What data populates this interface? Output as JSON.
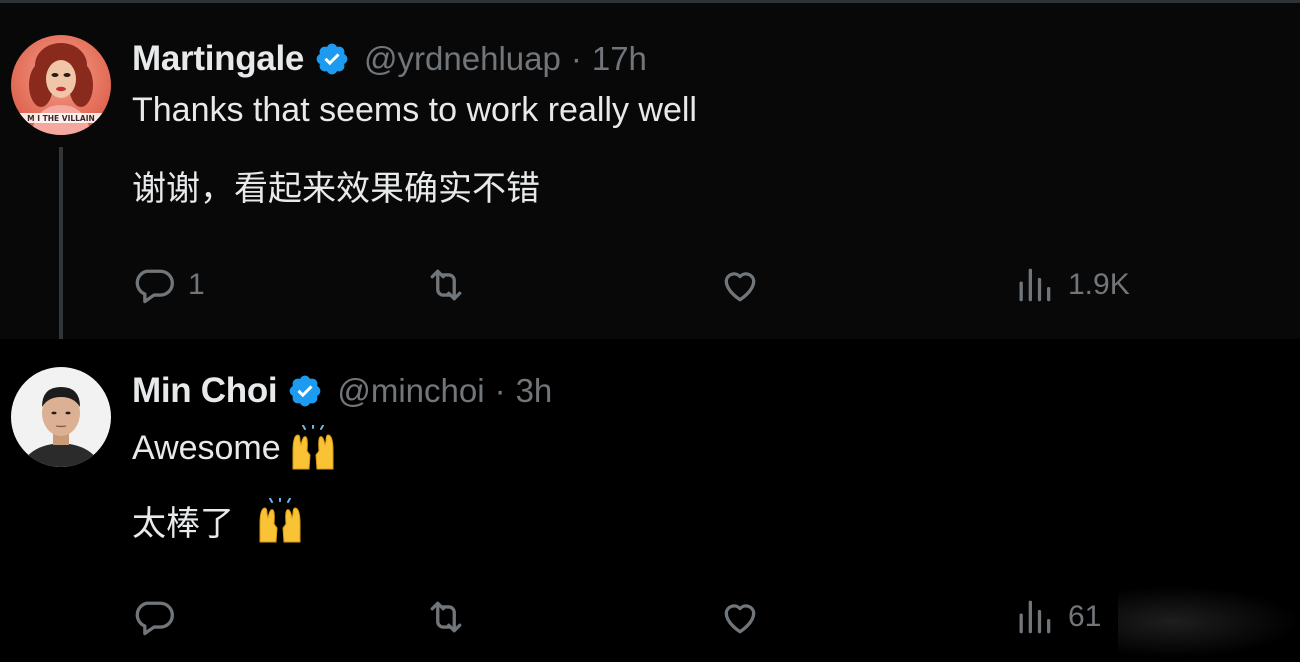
{
  "tweets": [
    {
      "display_name": "Martingale",
      "handle": "@yrdnehluap",
      "separator": "·",
      "time": "17h",
      "verified": true,
      "avatar": {
        "icon": "avatar-drag-queen",
        "caption": "M I THE VILLAIN",
        "colors": [
          "#e8685a",
          "#f3b59c",
          "#5a2a20"
        ]
      },
      "text_lines": [
        "Thanks that seems to work really well",
        "谢谢，看起来效果确实不错"
      ],
      "actions": {
        "reply": {
          "icon": "reply-icon",
          "count": "1"
        },
        "retweet": {
          "icon": "retweet-icon",
          "count": ""
        },
        "like": {
          "icon": "heart-icon",
          "count": ""
        },
        "views": {
          "icon": "views-icon",
          "count": "1.9K"
        }
      }
    },
    {
      "display_name": "Min Choi",
      "handle": "@minchoi",
      "separator": "·",
      "time": "3h",
      "verified": true,
      "avatar": {
        "icon": "avatar-man-portrait",
        "colors": [
          "#f2f2f2",
          "#2b2b2b",
          "#d9b08c"
        ]
      },
      "text_lines": [
        "Awesome",
        "太棒了"
      ],
      "emojis": [
        "raising-hands-emoji",
        "raising-hands-emoji"
      ],
      "actions": {
        "reply": {
          "icon": "reply-icon",
          "count": ""
        },
        "retweet": {
          "icon": "retweet-icon",
          "count": ""
        },
        "like": {
          "icon": "heart-icon",
          "count": ""
        },
        "views": {
          "icon": "views-icon",
          "count": "61"
        }
      }
    }
  ],
  "colors": {
    "background": "#000000",
    "tweet_highlight_bg": "#080808",
    "text_primary": "#e7e9ea",
    "text_secondary": "#71767b",
    "verified_blue": "#1d9bf0",
    "thread_line": "#333639"
  }
}
